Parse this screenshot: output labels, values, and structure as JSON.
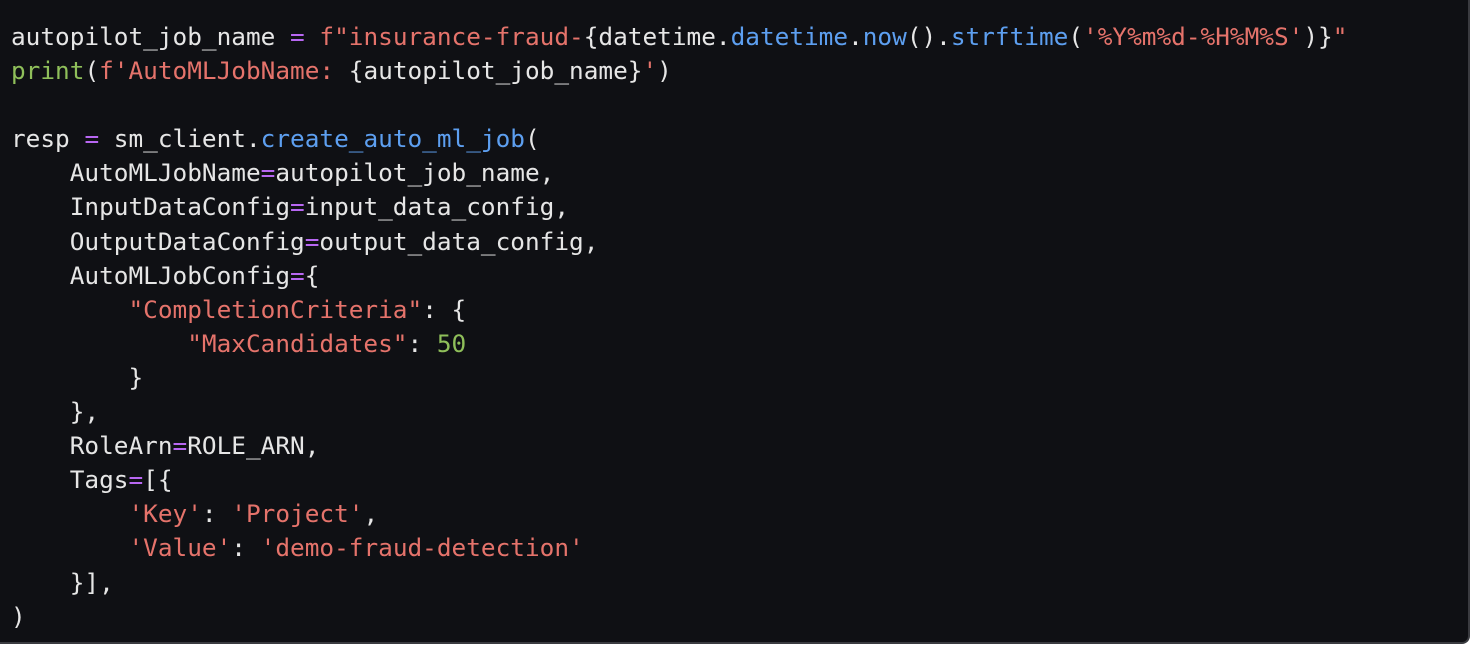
{
  "colors": {
    "background": "#0f1014",
    "plain": "#e6e6e6",
    "keyword_operator": "#b867f2",
    "string": "#e5736b",
    "function": "#5d9ff0",
    "builtin": "#8fbf5a",
    "number": "#8fbf5a"
  },
  "code": {
    "language": "python",
    "lines": [
      [
        {
          "t": "autopilot_job_name ",
          "c": "plain"
        },
        {
          "t": "=",
          "c": "kw"
        },
        {
          "t": " ",
          "c": "plain"
        },
        {
          "t": "f\"insurance-fraud-",
          "c": "str"
        },
        {
          "t": "{datetime.",
          "c": "plain"
        },
        {
          "t": "datetime",
          "c": "fn"
        },
        {
          "t": ".",
          "c": "plain"
        },
        {
          "t": "now",
          "c": "fn"
        },
        {
          "t": "().",
          "c": "plain"
        },
        {
          "t": "strftime",
          "c": "fn"
        },
        {
          "t": "(",
          "c": "plain"
        },
        {
          "t": "'%Y%m%d-%H%M%S'",
          "c": "str"
        },
        {
          "t": ")}",
          "c": "plain"
        },
        {
          "t": "\"",
          "c": "str"
        }
      ],
      [
        {
          "t": "print",
          "c": "builtin"
        },
        {
          "t": "(",
          "c": "plain"
        },
        {
          "t": "f'AutoMLJobName: ",
          "c": "str"
        },
        {
          "t": "{autopilot_job_name}",
          "c": "plain"
        },
        {
          "t": "'",
          "c": "str"
        },
        {
          "t": ")",
          "c": "plain"
        }
      ],
      [],
      [
        {
          "t": "resp ",
          "c": "plain"
        },
        {
          "t": "=",
          "c": "kw"
        },
        {
          "t": " sm_client.",
          "c": "plain"
        },
        {
          "t": "create_auto_ml_job",
          "c": "fn"
        },
        {
          "t": "(",
          "c": "plain"
        }
      ],
      [
        {
          "t": "    AutoMLJobName",
          "c": "plain"
        },
        {
          "t": "=",
          "c": "kw"
        },
        {
          "t": "autopilot_job_name,",
          "c": "plain"
        }
      ],
      [
        {
          "t": "    InputDataConfig",
          "c": "plain"
        },
        {
          "t": "=",
          "c": "kw"
        },
        {
          "t": "input_data_config,",
          "c": "plain"
        }
      ],
      [
        {
          "t": "    OutputDataConfig",
          "c": "plain"
        },
        {
          "t": "=",
          "c": "kw"
        },
        {
          "t": "output_data_config,",
          "c": "plain"
        }
      ],
      [
        {
          "t": "    AutoMLJobConfig",
          "c": "plain"
        },
        {
          "t": "=",
          "c": "kw"
        },
        {
          "t": "{",
          "c": "plain"
        }
      ],
      [
        {
          "t": "        ",
          "c": "plain"
        },
        {
          "t": "\"CompletionCriteria\"",
          "c": "str"
        },
        {
          "t": ": {",
          "c": "plain"
        }
      ],
      [
        {
          "t": "            ",
          "c": "plain"
        },
        {
          "t": "\"MaxCandidates\"",
          "c": "str"
        },
        {
          "t": ": ",
          "c": "plain"
        },
        {
          "t": "50",
          "c": "num"
        }
      ],
      [
        {
          "t": "        }",
          "c": "plain"
        }
      ],
      [
        {
          "t": "    },",
          "c": "plain"
        }
      ],
      [
        {
          "t": "    RoleArn",
          "c": "plain"
        },
        {
          "t": "=",
          "c": "kw"
        },
        {
          "t": "ROLE_ARN,",
          "c": "plain"
        }
      ],
      [
        {
          "t": "    Tags",
          "c": "plain"
        },
        {
          "t": "=",
          "c": "kw"
        },
        {
          "t": "[{",
          "c": "plain"
        }
      ],
      [
        {
          "t": "        ",
          "c": "plain"
        },
        {
          "t": "'Key'",
          "c": "str"
        },
        {
          "t": ": ",
          "c": "plain"
        },
        {
          "t": "'Project'",
          "c": "str"
        },
        {
          "t": ",",
          "c": "plain"
        }
      ],
      [
        {
          "t": "        ",
          "c": "plain"
        },
        {
          "t": "'Value'",
          "c": "str"
        },
        {
          "t": ": ",
          "c": "plain"
        },
        {
          "t": "'demo-fraud-detection'",
          "c": "str"
        }
      ],
      [
        {
          "t": "    }],",
          "c": "plain"
        }
      ],
      [
        {
          "t": ")",
          "c": "plain"
        }
      ]
    ]
  }
}
